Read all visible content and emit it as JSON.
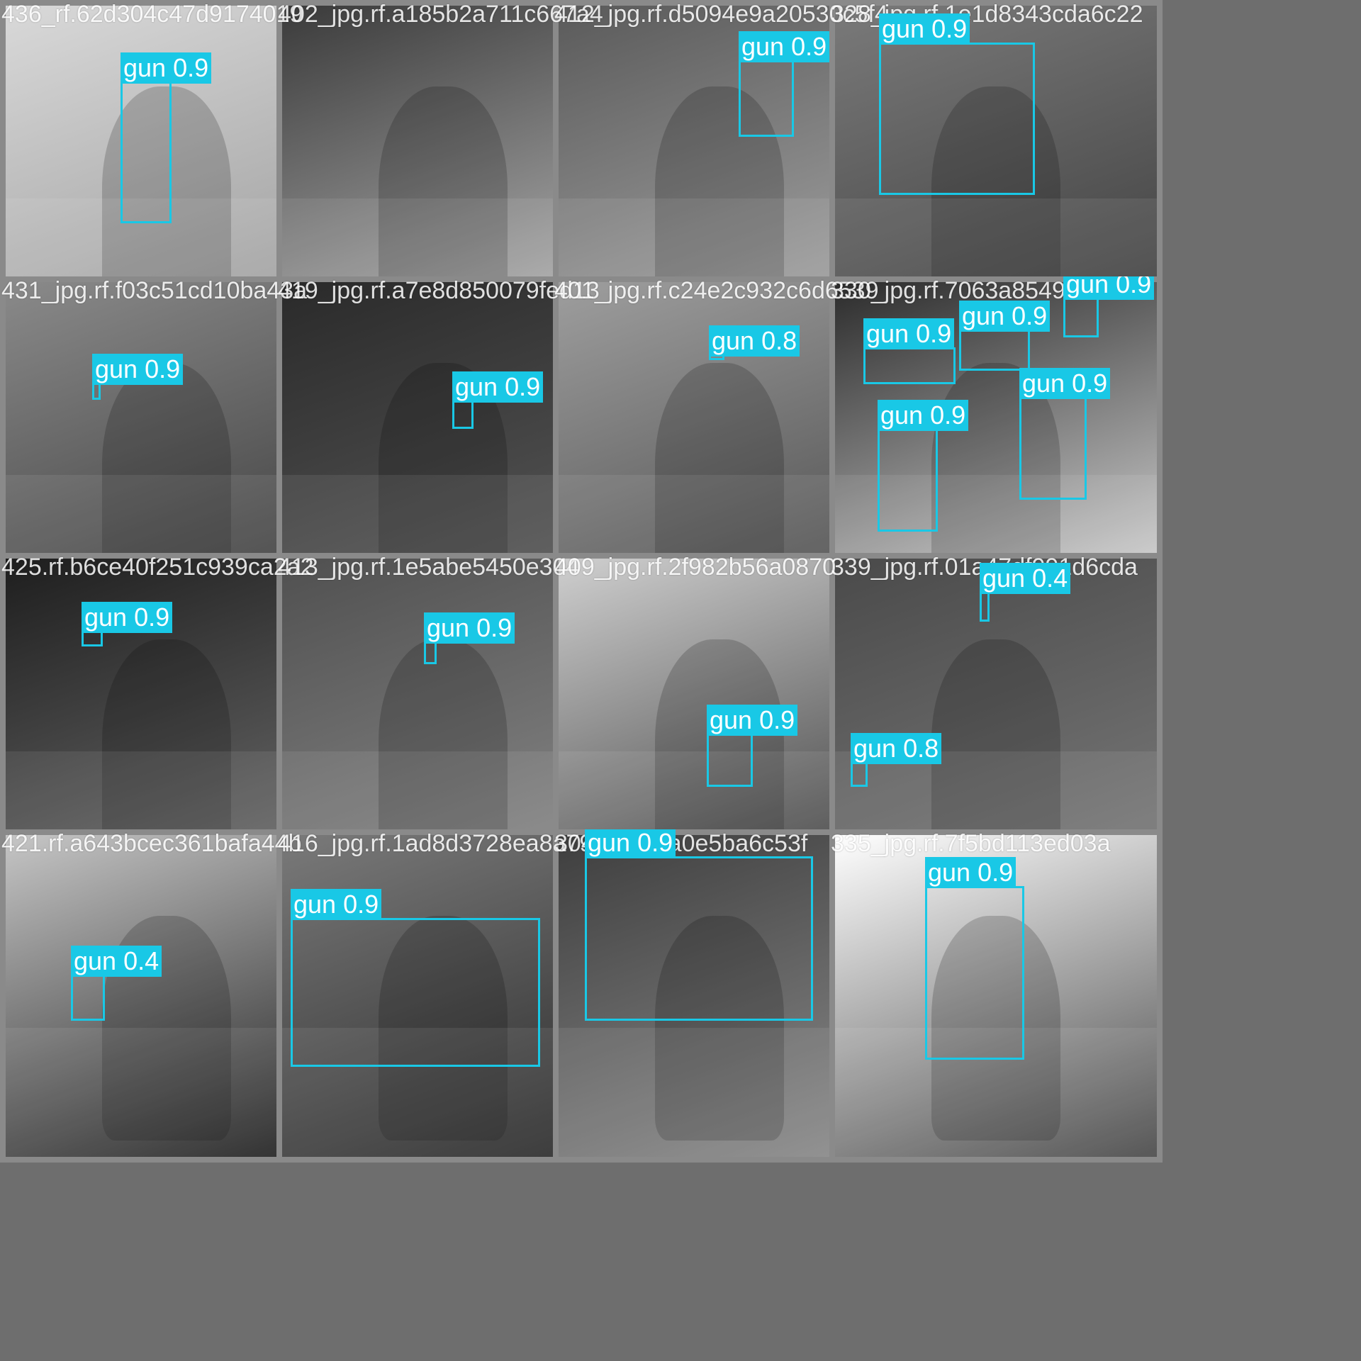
{
  "tiles": [
    {
      "filename": "436_rf.62d304c47d9174019",
      "detections": [
        {
          "label": "gun 0.9"
        }
      ]
    },
    {
      "filename": "402_jpg.rf.a185b2a711c667a4",
      "detections": []
    },
    {
      "filename": "412_jpg.rf.d5094e9a20530c5f47b728",
      "detections": [
        {
          "label": "gun 0.9"
        }
      ]
    },
    {
      "filename": "328_jpg.rf.1e1d8343cda6c22",
      "detections": [
        {
          "label": "gun 0.9"
        }
      ]
    },
    {
      "filename": "431_jpg.rf.f03c51cd10ba43a",
      "detections": [
        {
          "label": "gun 0.9"
        }
      ]
    },
    {
      "filename": "419_jpg.rf.a7e8d850079fed13",
      "detections": [
        {
          "label": "gun 0.9"
        }
      ]
    },
    {
      "filename": "401_jpg.rf.c24e2c932c6d6539",
      "detections": [
        {
          "label": "gun 0.8"
        }
      ]
    },
    {
      "filename": "330_jpg.rf.7063a8549fc8773",
      "detections": [
        {
          "label": "gun 0.9"
        },
        {
          "label": "gun 0.9"
        },
        {
          "label": "gun 0.9"
        },
        {
          "label": "gun 0.9"
        },
        {
          "label": "gun 0.9"
        }
      ]
    },
    {
      "filename": "425.rf.b6ce40f251c939ca2a2",
      "detections": [
        {
          "label": "gun 0.9"
        }
      ]
    },
    {
      "filename": "413_jpg.rf.1e5abe5450e304",
      "detections": [
        {
          "label": "gun 0.9"
        }
      ]
    },
    {
      "filename": "409_jpg.rf.2f982b56a0870",
      "detections": [
        {
          "label": "gun 0.9"
        }
      ]
    },
    {
      "filename": "339_jpg.rf.01a47df991d6cda",
      "detections": [
        {
          "label": "gun 0.4"
        },
        {
          "label": "gun 0.8"
        }
      ]
    },
    {
      "filename": "421.rf.a643bcec361bafa44b",
      "detections": [
        {
          "label": "gun 0.4"
        }
      ]
    },
    {
      "filename": "416_jpg.rf.1ad8d3728ea8a7910",
      "detections": [
        {
          "label": "gun 0.9"
        }
      ]
    },
    {
      "filename": "304_jpg.rf.a0e5ba6c53f",
      "detections": [
        {
          "label": "gun 0.9"
        }
      ]
    },
    {
      "filename": "335_jpg.rf.7f5bd113ed03a",
      "detections": [
        {
          "label": "gun 0.9"
        }
      ]
    }
  ],
  "colors": {
    "box": "#19c8e6",
    "label_text": "#ffffff",
    "filename_text": "#ffffff"
  }
}
